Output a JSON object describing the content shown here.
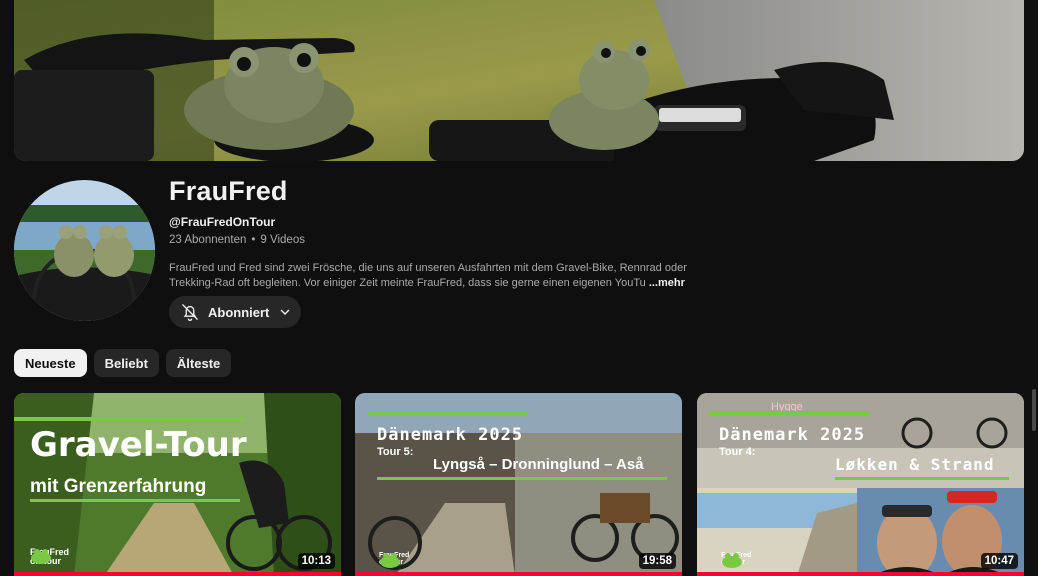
{
  "banner": {},
  "channel": {
    "name": "FrauFred",
    "handle": "@FrauFredOnTour",
    "subscribers": "23 Abonnenten",
    "separator": "•",
    "videos": "9 Videos",
    "description_line1": "FrauFred und Fred sind zwei Frösche, die uns auf unseren Ausfahrten mit dem Gravel-Bike, Rennrad oder",
    "description_line2": "Trekking-Rad oft begleiten. Vor einiger Zeit meinte FrauFred, dass sie gerne einen eigenen YouTu",
    "more_label": "...mehr",
    "subscribe_label": "Abonniert"
  },
  "filters": {
    "items": [
      {
        "label": "Neueste",
        "active": true
      },
      {
        "label": "Beliebt",
        "active": false
      },
      {
        "label": "Älteste",
        "active": false
      }
    ]
  },
  "videos": [
    {
      "title_line1": "Gravel-Tour",
      "title_line2": "mit Grenzerfahrung",
      "brand_line1": "FrauFred",
      "brand_line2": "on tour",
      "duration": "10:13",
      "watched_fraction": 1.0
    },
    {
      "title_line1": "Dänemark 2025",
      "subtitle": "Tour 5:",
      "title_line2": "Lyngså – Dronninglund – Aså",
      "brand_line1": "FrauFred",
      "brand_line2": "on tour",
      "duration": "19:58",
      "watched_fraction": 1.0
    },
    {
      "title_line1": "Dänemark 2025",
      "subtitle": "Tour 4:",
      "title_line2": "Løkken & Strand",
      "overlay_text": "Hygge",
      "brand_line1": "FrauFred",
      "brand_line2": "on tour",
      "duration": "10:47",
      "watched_fraction": 1.0
    }
  ],
  "colors": {
    "background": "#0f0f0f",
    "chip_bg": "#272727",
    "chip_active_bg": "#f1f1f1",
    "progress": "#ff0033",
    "accent_green": "#7ac943"
  },
  "icons": {
    "subscribe_bell": "bell-off-icon",
    "subscribe_chevron": "chevron-down-icon"
  }
}
